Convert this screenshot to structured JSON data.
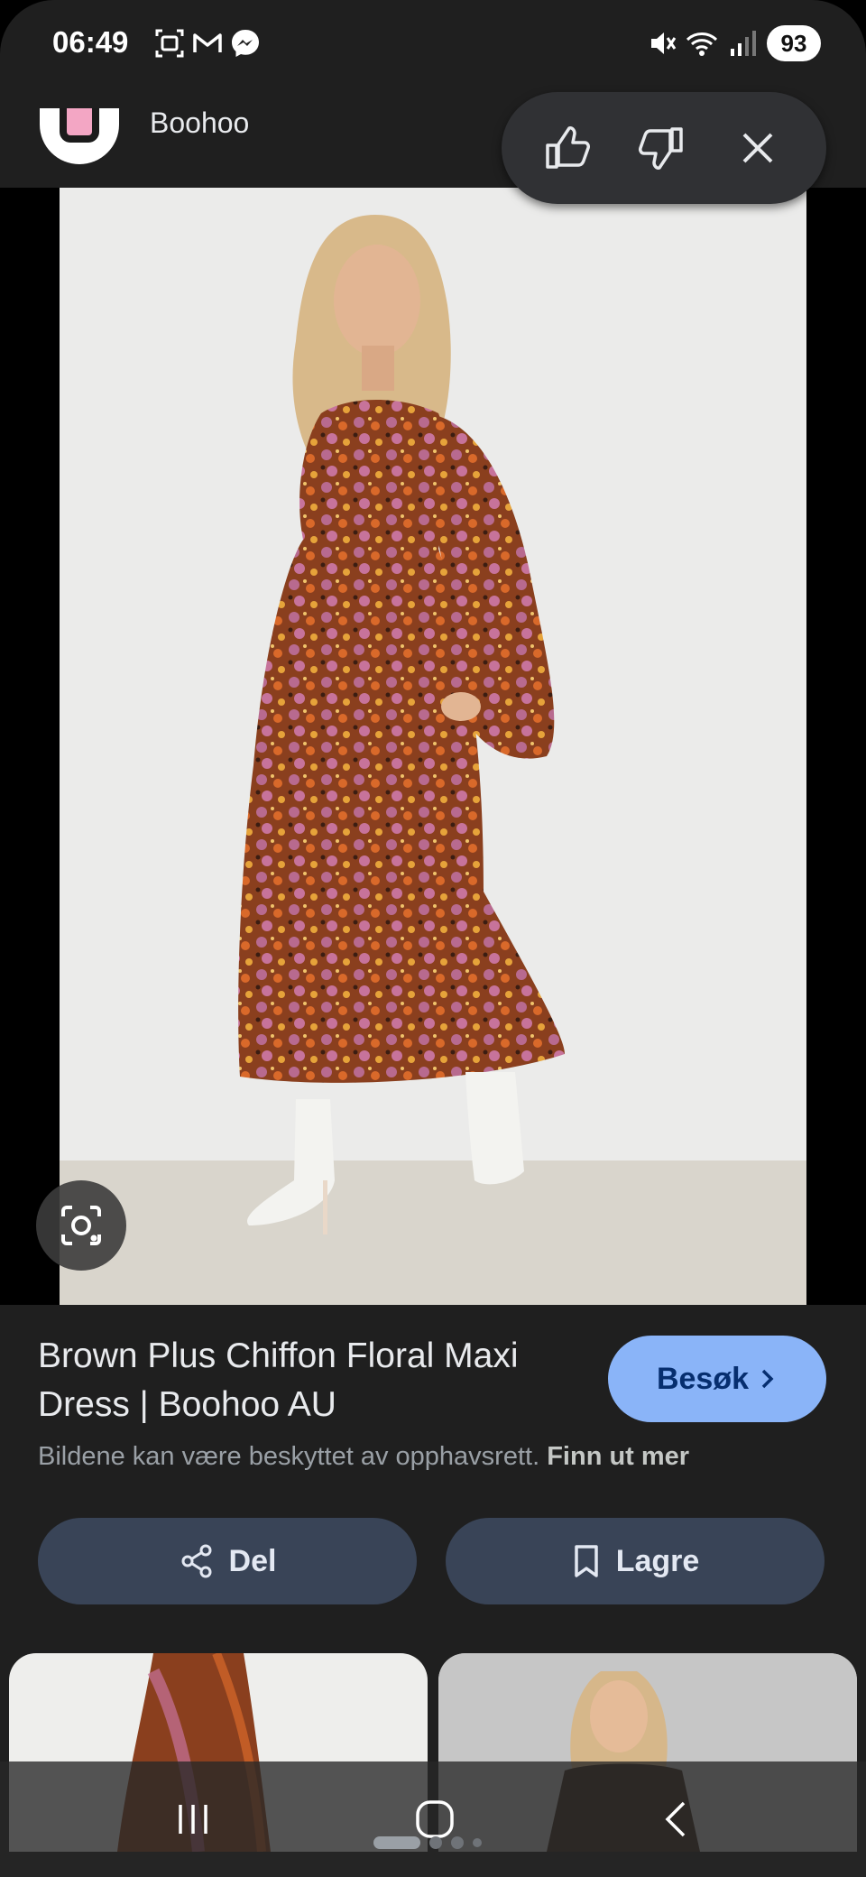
{
  "status_bar": {
    "time": "06:49",
    "battery": "93",
    "left_icons": [
      "screenshot-icon",
      "gmail-icon",
      "messenger-icon"
    ],
    "right_icons": [
      "mute-icon",
      "wifi-icon",
      "signal-icon"
    ]
  },
  "header": {
    "site_name": "Boohoo",
    "feedback_icons": [
      "thumbs-up-icon",
      "thumbs-down-icon",
      "close-icon"
    ]
  },
  "result": {
    "title": "Brown Plus Chiffon Floral Maxi Dress | Boohoo AU",
    "visit_label": "Besøk",
    "copyright_text": "Bildene kan være beskyttet av opphavsrett.",
    "learn_more": "Finn ut mer"
  },
  "actions": {
    "share_label": "Del",
    "save_label": "Lagre"
  },
  "colors": {
    "background": "#1f1f1f",
    "accent": "#8ab4f8",
    "action_button": "#394457"
  }
}
